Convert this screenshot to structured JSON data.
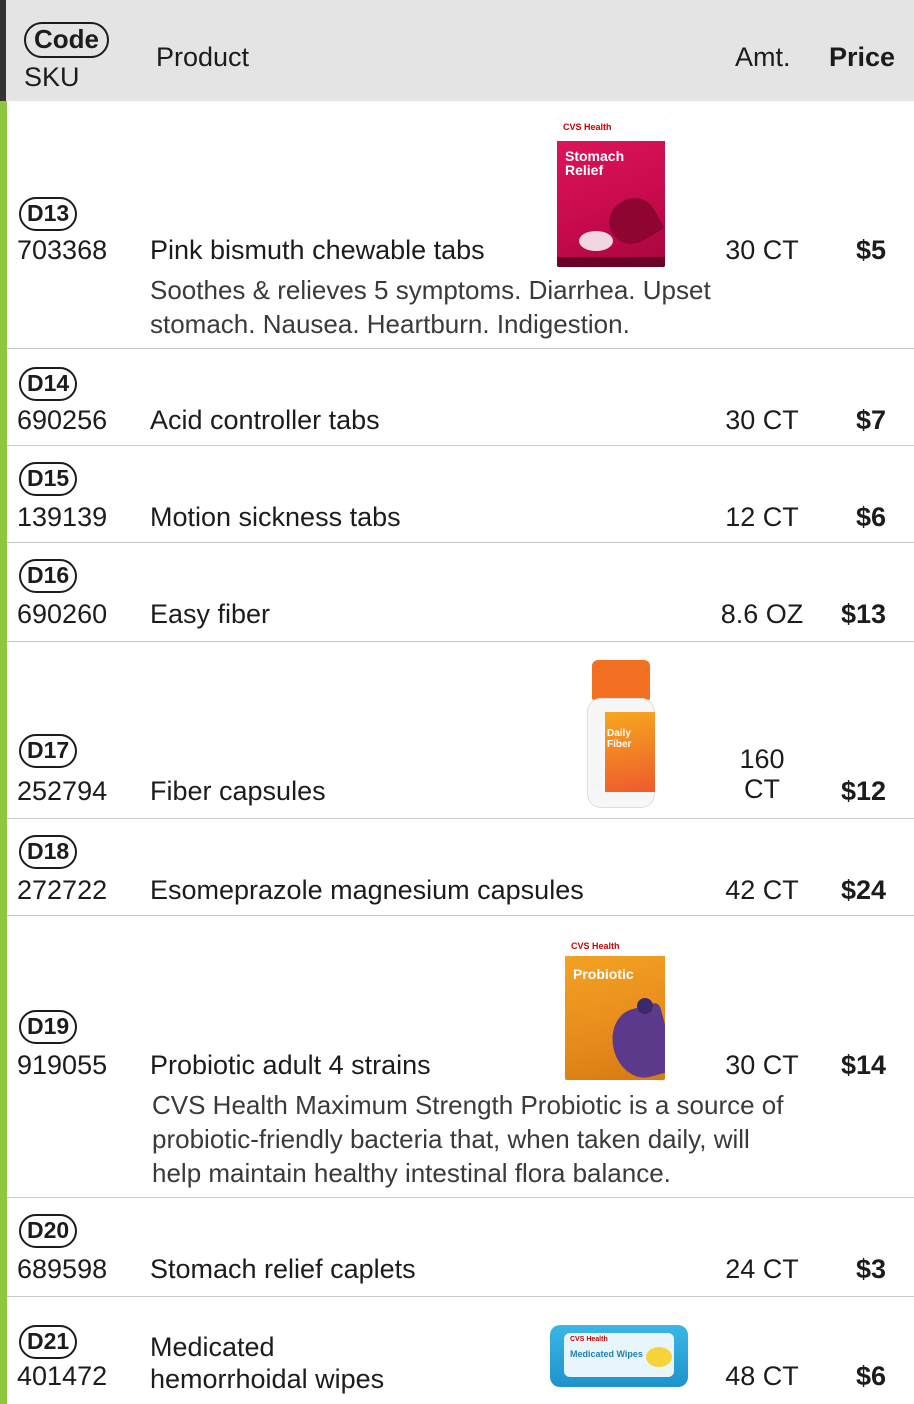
{
  "header": {
    "code_label": "Code",
    "sku_label": "SKU",
    "product_label": "Product",
    "amt_label": "Amt.",
    "price_label": "Price"
  },
  "items": [
    {
      "code": "D13",
      "sku": "703368",
      "product": "Pink bismuth chewable tabs",
      "amt": "30 CT",
      "price": "$5",
      "description": [
        "Soothes & relieves 5 symptoms. Diarrhea. Upset",
        "stomach. Nausea. Heartburn. Indigestion."
      ],
      "image_text": {
        "brand": "CVS Health",
        "title": "Stomach Relief"
      }
    },
    {
      "code": "D14",
      "sku": "690256",
      "product": "Acid controller tabs",
      "amt": "30 CT",
      "price": "$7"
    },
    {
      "code": "D15",
      "sku": "139139",
      "product": "Motion sickness tabs",
      "amt": "12 CT",
      "price": "$6"
    },
    {
      "code": "D16",
      "sku": "690260",
      "product": "Easy fiber",
      "amt": "8.6 OZ",
      "price": "$13"
    },
    {
      "code": "D17",
      "sku": "252794",
      "product": "Fiber capsules",
      "amt": [
        "160",
        "CT"
      ],
      "price": "$12",
      "image_text": {
        "title": "Daily Fiber"
      }
    },
    {
      "code": "D18",
      "sku": "272722",
      "product": "Esomeprazole magnesium capsules",
      "amt": "42 CT",
      "price": "$24"
    },
    {
      "code": "D19",
      "sku": "919055",
      "product": "Probiotic adult 4 strains",
      "amt": "30 CT",
      "price": "$14",
      "description": [
        "CVS Health Maximum Strength Probiotic is a source of",
        "probiotic-friendly bacteria that, when taken daily, will",
        "help maintain healthy intestinal flora balance."
      ],
      "image_text": {
        "brand": "CVS Health",
        "title": "Probiotic"
      }
    },
    {
      "code": "D20",
      "sku": "689598",
      "product": "Stomach relief caplets",
      "amt": "24 CT",
      "price": "$3"
    },
    {
      "code": "D21",
      "sku": "401472",
      "product": [
        "Medicated",
        "hemorrhoidal wipes"
      ],
      "amt": "48 CT",
      "price": "$6",
      "image_text": {
        "brand": "CVS Health",
        "title": "Medicated Wipes"
      }
    }
  ]
}
